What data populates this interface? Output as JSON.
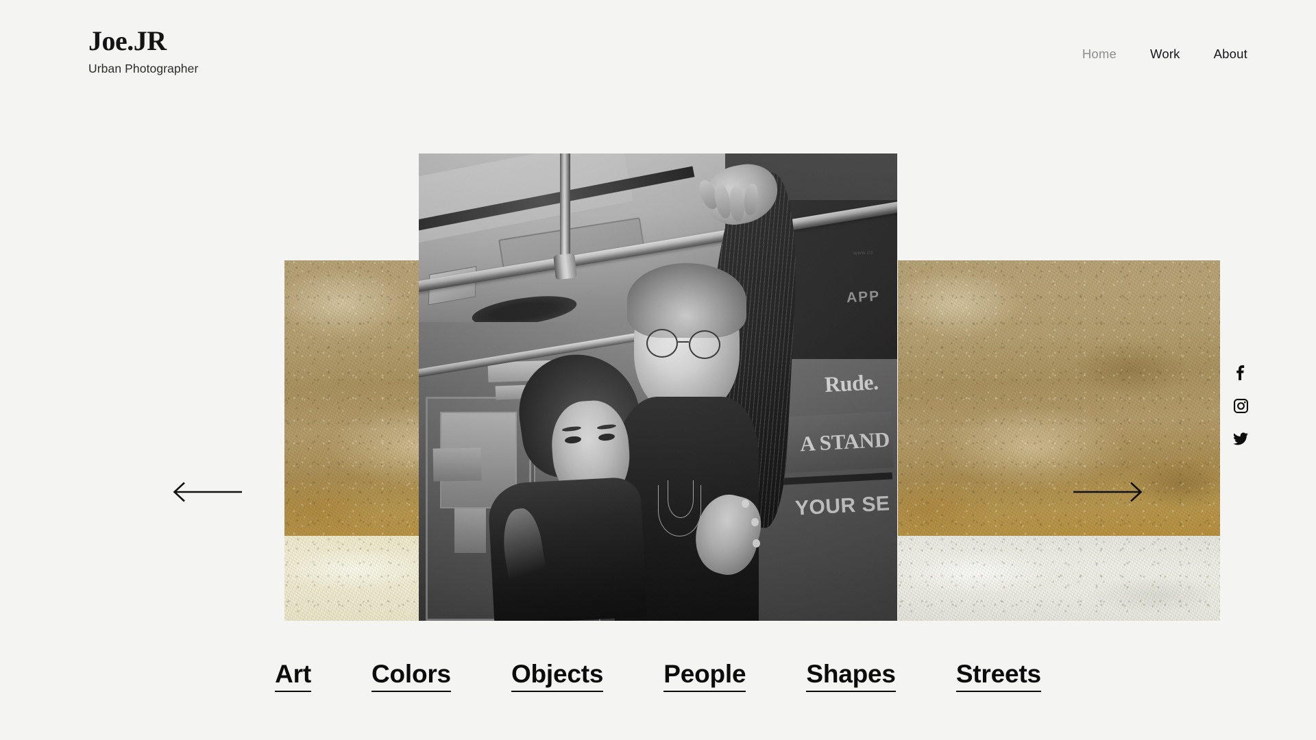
{
  "brand": {
    "name": "Joe.JR",
    "tagline": "Urban Photographer"
  },
  "nav": {
    "items": [
      {
        "label": "Home",
        "state": "muted"
      },
      {
        "label": "Work",
        "state": "normal"
      },
      {
        "label": "About",
        "state": "normal"
      }
    ]
  },
  "social": {
    "items": [
      {
        "icon": "facebook-icon",
        "label": "Facebook"
      },
      {
        "icon": "instagram-icon",
        "label": "Instagram"
      },
      {
        "icon": "twitter-icon",
        "label": "Twitter"
      }
    ]
  },
  "carousel": {
    "prev_label": "Previous",
    "next_label": "Next",
    "photo": {
      "description": "Black and white photograph of a couple standing together inside a subway car, holding an overhead handrail",
      "treatment": "black-and-white",
      "ad_text": {
        "headline": "Rude.",
        "line_2": "A STAND",
        "line_3": "YOUR SE",
        "panel_word": "APP",
        "panel_url": "WWW.CS"
      }
    },
    "texture_panels": [
      {
        "position": "left",
        "description": "gold and cream textured wall"
      },
      {
        "position": "right",
        "description": "gold and white textured wall"
      }
    ]
  },
  "categories": {
    "items": [
      {
        "label": "Art"
      },
      {
        "label": "Colors"
      },
      {
        "label": "Objects"
      },
      {
        "label": "People"
      },
      {
        "label": "Shapes"
      },
      {
        "label": "Streets"
      }
    ]
  },
  "colors": {
    "background": "#f4f4f3",
    "text": "#0c0c0c",
    "muted_text": "#8d8d8d",
    "texture_gold": "#b39a63",
    "texture_cream": "#efecd1"
  }
}
